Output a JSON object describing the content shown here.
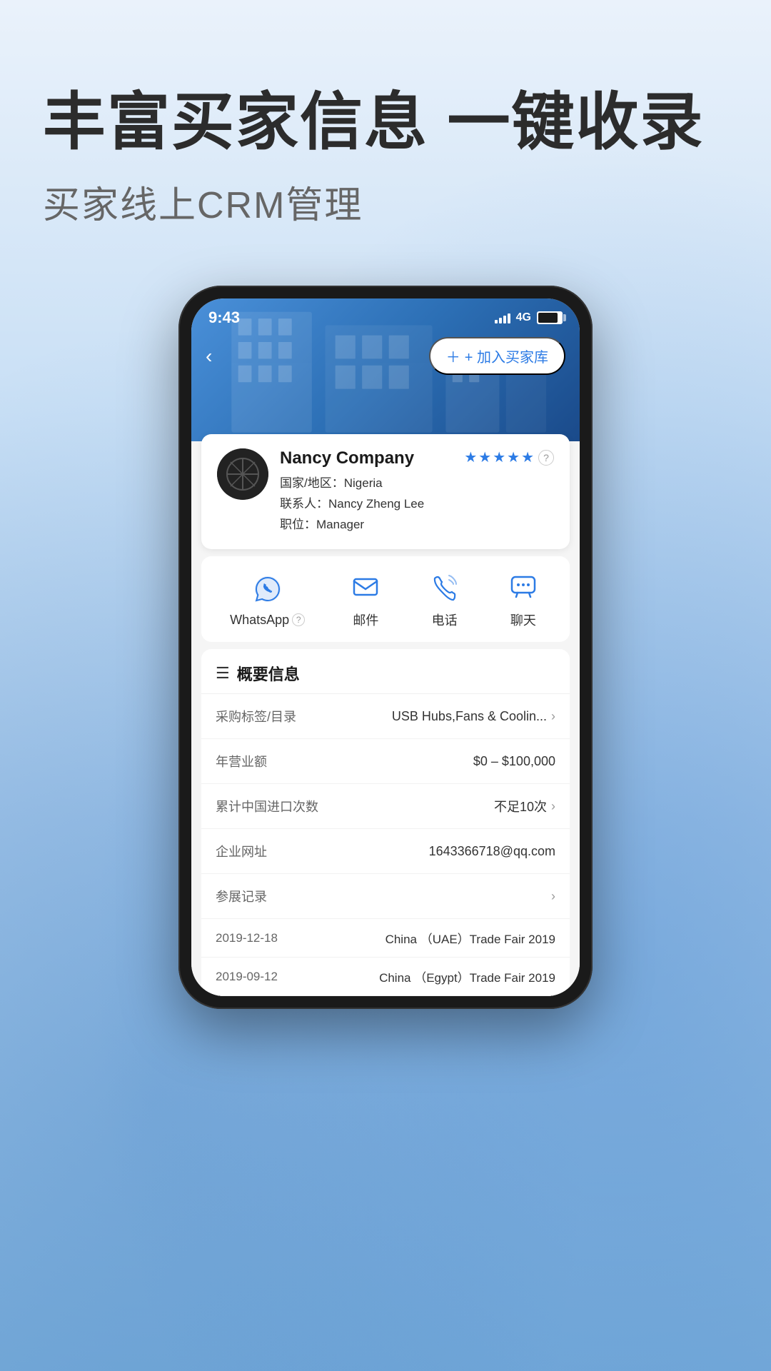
{
  "header": {
    "main_title": "丰富买家信息 一键收录",
    "subtitle": "买家线上CRM管理"
  },
  "phone": {
    "status_bar": {
      "time": "9:43",
      "network": "4G"
    },
    "nav": {
      "back_label": "‹",
      "add_button_label": "+ 加入买家库"
    },
    "company": {
      "name": "Nancy Company",
      "country_label": "国家/地区：",
      "country": "Nigeria",
      "contact_label": "联系人：",
      "contact": "Nancy Zheng Lee",
      "position_label": "职位：",
      "position": "Manager",
      "stars": 5,
      "rating_value": "5"
    },
    "actions": [
      {
        "id": "whatsapp",
        "label": "WhatsApp",
        "has_help": true
      },
      {
        "id": "email",
        "label": "邮件",
        "has_help": false
      },
      {
        "id": "phone",
        "label": "电话",
        "has_help": false
      },
      {
        "id": "chat",
        "label": "聊天",
        "has_help": false
      }
    ],
    "overview_section": {
      "title": "概要信息",
      "rows": [
        {
          "label": "采购标签/目录",
          "value": "USB Hubs,Fans & Coolin...",
          "has_chevron": true
        },
        {
          "label": "年营业额",
          "value": "$0 – $100,000",
          "has_chevron": false
        },
        {
          "label": "累计中国进口次数",
          "value": "不足10次",
          "has_chevron": true
        },
        {
          "label": "企业网址",
          "value": "1643366718@qq.com",
          "has_chevron": false
        },
        {
          "label": "参展记录",
          "value": "",
          "has_chevron": true
        }
      ],
      "trade_fairs": [
        {
          "date": "2019-12-18",
          "name": "China （UAE）Trade Fair 2019"
        },
        {
          "date": "2019-09-12",
          "name": "China （Egypt）Trade Fair 2019"
        }
      ]
    }
  }
}
